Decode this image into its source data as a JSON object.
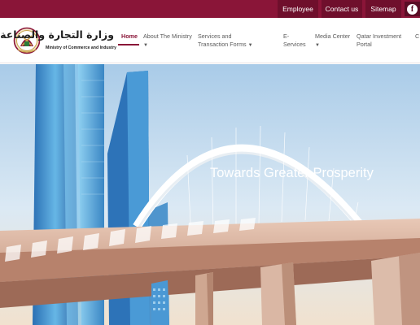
{
  "topbar": {
    "links": {
      "employee": "Employee",
      "contact": "Contact us",
      "sitemap": "Sitemap"
    },
    "social_icon": "facebook-icon"
  },
  "header": {
    "logo": {
      "arabic": "وزارة التجارة والصناعة",
      "english": "Ministry of Commerce and Industry"
    },
    "nav": {
      "home": "Home",
      "about": "About The Ministry",
      "services": "Services and Transaction Forms",
      "eservices": "E-Services",
      "media": "Media Center",
      "qip": "Qatar Investment Portal",
      "cut": "C"
    }
  },
  "hero": {
    "slogan": "Towards Greater Prosperity"
  },
  "colors": {
    "brand_maroon": "#8a1538",
    "sky": "#cfe1f0"
  }
}
